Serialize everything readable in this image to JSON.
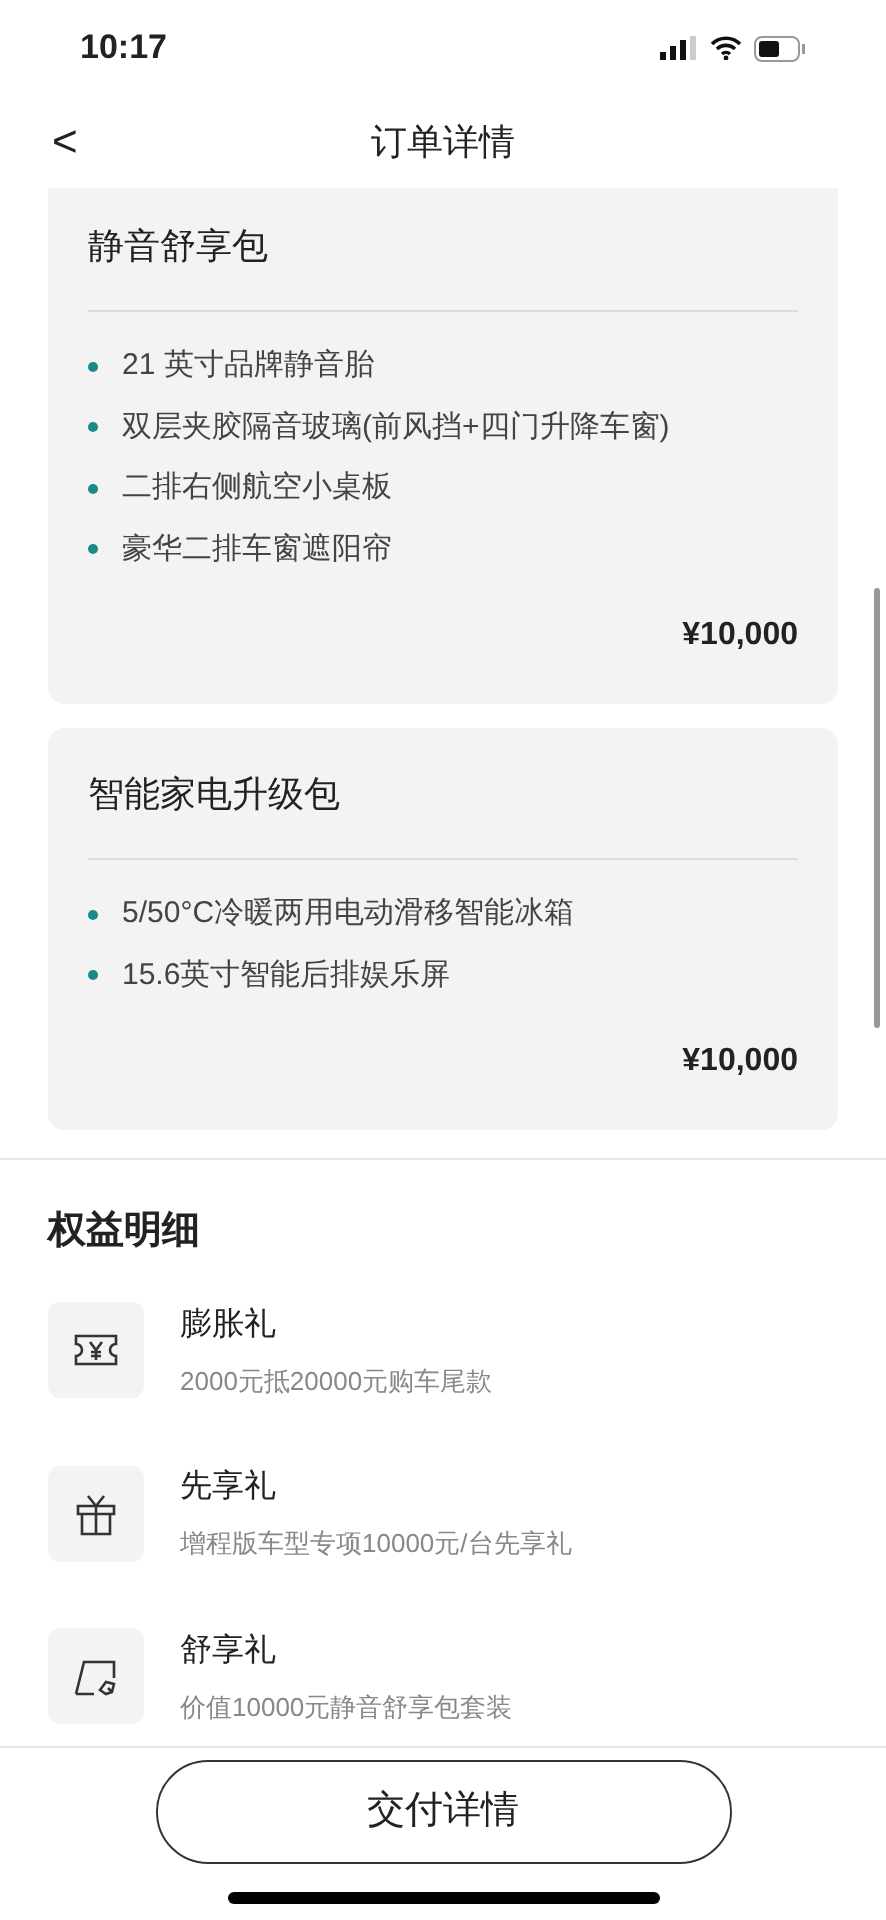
{
  "status_bar": {
    "time": "10:17"
  },
  "nav": {
    "back": "<",
    "title": "订单详情"
  },
  "packages": [
    {
      "name": "静音舒享包",
      "features": [
        "21 英寸品牌静音胎",
        "双层夹胶隔音玻璃(前风挡+四门升降车窗)",
        "二排右侧航空小桌板",
        "豪华二排车窗遮阳帘"
      ],
      "price": "¥10,000"
    },
    {
      "name": "智能家电升级包",
      "features": [
        "5/50°C冷暖两用电动滑移智能冰箱",
        "15.6英寸智能后排娱乐屏"
      ],
      "price": "¥10,000"
    }
  ],
  "benefits": {
    "title": "权益明细",
    "items": [
      {
        "kind": "voucher",
        "name": "膨胀礼",
        "desc": "2000元抵20000元购车尾款"
      },
      {
        "kind": "gift",
        "name": "先享礼",
        "desc": "增程版车型专项10000元/台先享礼"
      },
      {
        "kind": "window",
        "name": "舒享礼",
        "desc": "价值10000元静音舒享包套装"
      }
    ]
  },
  "footer": {
    "button": "交付详情"
  }
}
